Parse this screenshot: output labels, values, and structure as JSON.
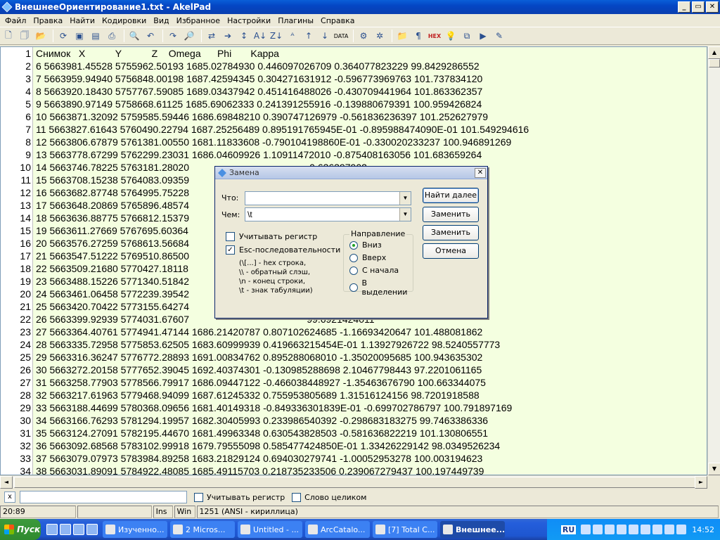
{
  "window": {
    "title": "ВнешнееОриентирование1.txt - AkelPad",
    "min": "_",
    "max": "▭",
    "close": "✕"
  },
  "menu": [
    "Файл",
    "Правка",
    "Найти",
    "Кодировки",
    "Вид",
    "Избранное",
    "Настройки",
    "Плагины",
    "Справка"
  ],
  "toolbar": {
    "icons": [
      "new-file-icon",
      "new-window-icon",
      "open-icon",
      "reload-icon",
      "save-icon",
      "save-all-icon",
      "print-icon",
      "print-preview-icon",
      "undo-icon",
      "redo-icon",
      "find-icon",
      "replace-icon",
      "goto-icon",
      "sort-icon",
      "sort-asc-icon",
      "sort-desc-icon",
      "case-icon",
      "upper-icon",
      "lower-icon",
      "data-icon",
      "settings-icon",
      "gear-icon",
      "folder-icon",
      "paragraph-icon",
      "hex-icon",
      "bulb-icon",
      "copy-icon",
      "run-icon",
      "tools-icon"
    ],
    "hex_label": "HEX",
    "data_label": "DATA"
  },
  "editor": {
    "lines": [
      {
        "n": "1",
        "t": "Снимок   X           Y           Z    Omega      Phi       Kappa"
      },
      {
        "n": "2",
        "t": "6 5663981.45528 5755962.50193 1685.02784930 0.446097026709 0.364077823229 99.8429286552"
      },
      {
        "n": "3",
        "t": "7 5663959.94940 5756848.00198 1687.42594345 0.304271631912 -0.596773969763 101.737834120"
      },
      {
        "n": "4",
        "t": "8 5663920.18430 5757767.59085 1689.03437942 0.451416488026 -0.430709441964 101.863362357"
      },
      {
        "n": "5",
        "t": "9 5663890.97149 5758668.61125 1685.69062333 0.241391255916 -0.139880679391 100.959426824"
      },
      {
        "n": "6",
        "t": "10 5663871.32092 5759585.59446 1686.69848210 0.390747126979 -0.561836236397 101.252627979"
      },
      {
        "n": "7",
        "t": "11 5663827.61643 5760490.22794 1687.25256489 0.895191765945E-01 -0.895988474090E-01 101.549294616"
      },
      {
        "n": "8",
        "t": "12 5663806.67879 5761381.00550 1681.11833608 -0.790104198860E-01 -0.330020233237 100.946891269"
      },
      {
        "n": "9",
        "t": "13 5663778.67299 5762299.23031 1686.04609926 1.10911472010 -0.875408163056 101.683659264"
      },
      {
        "n": "10",
        "t": "14 5663746.78225 5763181.28020                                            0.636397902"
      },
      {
        "n": "11",
        "t": "15 5663708.15238 5764083.09359                                           99.4328133703"
      },
      {
        "n": "12",
        "t": "16 5663682.87748 5764995.75228                                           01 100.087560836"
      },
      {
        "n": "13",
        "t": "17 5663648.20869 5765896.48574                                           0.115772120"
      },
      {
        "n": "14",
        "t": "18 5663636.88775 5766812.15379                                           0744271943"
      },
      {
        "n": "15",
        "t": "19 5663611.27669 5767695.60364                                           9698281953"
      },
      {
        "n": "16",
        "t": "20 5663576.27259 5768613.56684                                           01 100.954166749"
      },
      {
        "n": "17",
        "t": "21 5663547.51222 5769510.86500                                           01 100.526359453"
      },
      {
        "n": "18",
        "t": "22 5663509.21680 5770427.18118                                           01 100.539262303"
      },
      {
        "n": "19",
        "t": "23 5663488.15226 5771340.51842                                           98.0608759053"
      },
      {
        "n": "20",
        "t": "24 5663461.06458 5772239.39542                                           .998071822"
      },
      {
        "n": "21",
        "t": "25 5663420.70422 5773155.64274                                           0.214886835"
      },
      {
        "n": "22",
        "t": "26 5663399.92939 5774031.67607                                           99.6921424011"
      },
      {
        "n": "23",
        "t": "27 5663364.40761 5774941.47144 1686.21420787 0.807102624685 -1.16693420647 101.488081862"
      },
      {
        "n": "24",
        "t": "28 5663335.72958 5775853.62505 1683.60999939 0.419663215454E-01 1.13927926722 98.5240557773"
      },
      {
        "n": "25",
        "t": "29 5663316.36247 5776772.28893 1691.00834762 0.895288068010 -1.35020095685 100.943635302"
      },
      {
        "n": "26",
        "t": "30 5663272.20158 5777652.39045 1692.40374301 -0.130985288698 2.10467798443 97.2201061165"
      },
      {
        "n": "27",
        "t": "31 5663258.77903 5778566.79917 1686.09447122 -0.466038448927 -1.35463676790 100.663344075"
      },
      {
        "n": "28",
        "t": "32 5663217.61963 5779468.94099 1687.61245332 0.755953805689 1.31516124156 98.7201918588"
      },
      {
        "n": "29",
        "t": "33 5663188.44699 5780368.09656 1681.40149318 -0.849336301839E-01 -0.699702786797 100.791897169"
      },
      {
        "n": "30",
        "t": "34 5663166.76293 5781294.19957 1682.30405993 0.233986540392 -0.298683183275 99.7463386336"
      },
      {
        "n": "31",
        "t": "35 5663124.27091 5782195.44670 1681.49963348 0.630543828503 -0.581636822219 101.130806551"
      },
      {
        "n": "32",
        "t": "36 5663092.68568 5783102.99918 1679.79555098 0.585477424850E-01 1.33426229142 98.0349526234"
      },
      {
        "n": "33",
        "t": "37 5663079.07973 5783984.89258 1683.21829124 0.694030279741 -1.00052953278 100.003194623"
      },
      {
        "n": "34",
        "t": "38 5663031.89091 5784922.48085 1685.49115703 0.218735233506 0.239067279437 100.197449739"
      }
    ]
  },
  "dialog": {
    "title": "Замена",
    "close": "✕",
    "what_label": "Что:",
    "what_value": "",
    "with_label": "Чем:",
    "with_value": "\\t",
    "buttons": {
      "find_next": "Найти далее",
      "replace": "Заменить",
      "replace_all": "Заменить всё",
      "cancel": "Отмена"
    },
    "match_case": {
      "label": "Учитывать регистр",
      "checked": false
    },
    "esc_seq": {
      "label": "Esc-последовательности",
      "checked": true
    },
    "hints": [
      "(\\[...] - hex строка,",
      "\\\\ - обратный слэш,",
      "\\n - конец строки,",
      "\\t - знак табуляции)"
    ],
    "direction": {
      "title": "Направление",
      "options": [
        {
          "label": "Вниз",
          "selected": true
        },
        {
          "label": "Вверх",
          "selected": false
        },
        {
          "label": "С начала",
          "selected": false
        },
        {
          "label": "В выделении",
          "selected": false
        }
      ]
    },
    "drop_glyph": "▼",
    "check_glyph": "✓"
  },
  "quick_search": {
    "close": "x",
    "match_case": "Учитывать регистр",
    "whole_word": "Слово целиком"
  },
  "status": {
    "pos": "20:89",
    "empty": "",
    "ins": "Ins",
    "eol": "Win",
    "encoding": "1251  (ANSI - кириллица)"
  },
  "taskbar": {
    "start": "Пуск",
    "tasks": [
      {
        "label": "Изученно...",
        "active": false
      },
      {
        "label": "2 Micros...",
        "active": false
      },
      {
        "label": "Untitled - ...",
        "active": false
      },
      {
        "label": "ArcCatalo...",
        "active": false
      },
      {
        "label": "[7] Total C...",
        "active": false
      },
      {
        "label": "Внешнее...",
        "active": true
      }
    ],
    "lang": "RU",
    "clock": "14:52"
  }
}
